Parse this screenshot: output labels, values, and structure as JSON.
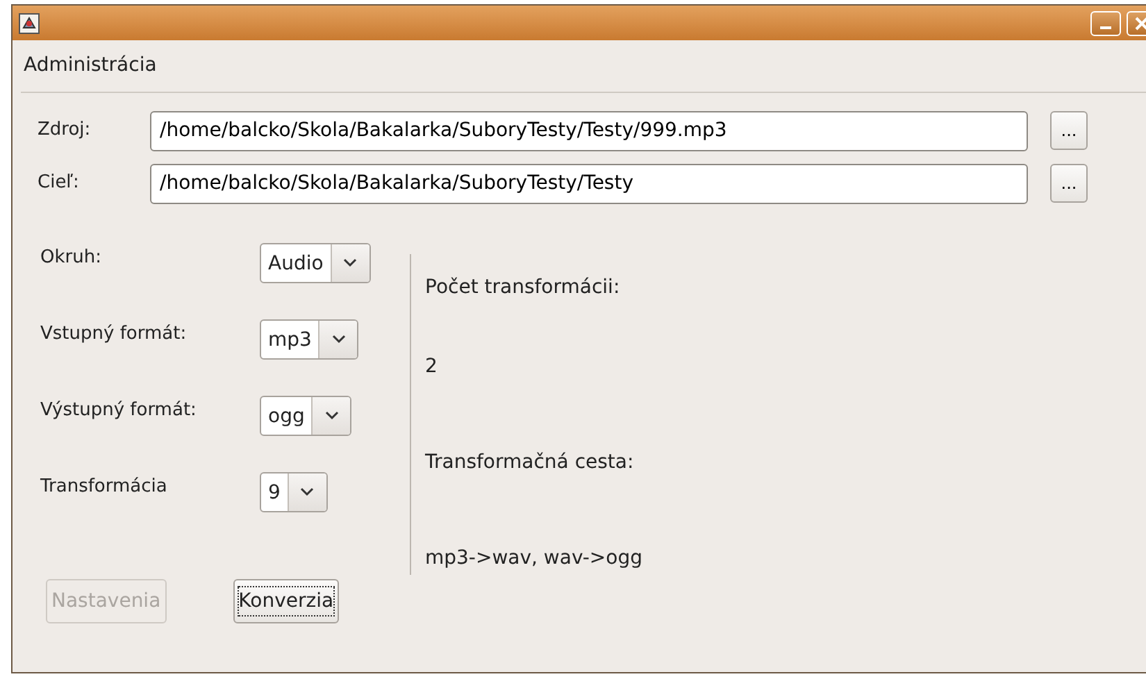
{
  "menu": [
    "Administrácia"
  ],
  "paths": [
    {
      "label": "Zdroj:",
      "value": "/home/balcko/Skola/Bakalarka/SuboryTesty/Testy/999.mp3",
      "button": "..."
    },
    {
      "label": "Cieľ:",
      "value": "/home/balcko/Skola/Bakalarka/SuboryTesty/Testy",
      "button": "..."
    }
  ],
  "options": [
    {
      "label": "Okruh:",
      "value": "Audio"
    },
    {
      "label": "Vstupný formát:",
      "value": "mp3"
    },
    {
      "label": "Výstupný formát:",
      "value": "ogg"
    },
    {
      "label": "Transformácia",
      "value": "9"
    }
  ],
  "info": [
    "Počet transformácii:",
    "2",
    "Transformačná cesta:",
    "mp3->wav, wav->ogg"
  ],
  "buttons": [
    {
      "label": "Nastavenia",
      "disabled": true,
      "focused": false
    },
    {
      "label": "Konverzia",
      "disabled": false,
      "focused": true
    }
  ]
}
